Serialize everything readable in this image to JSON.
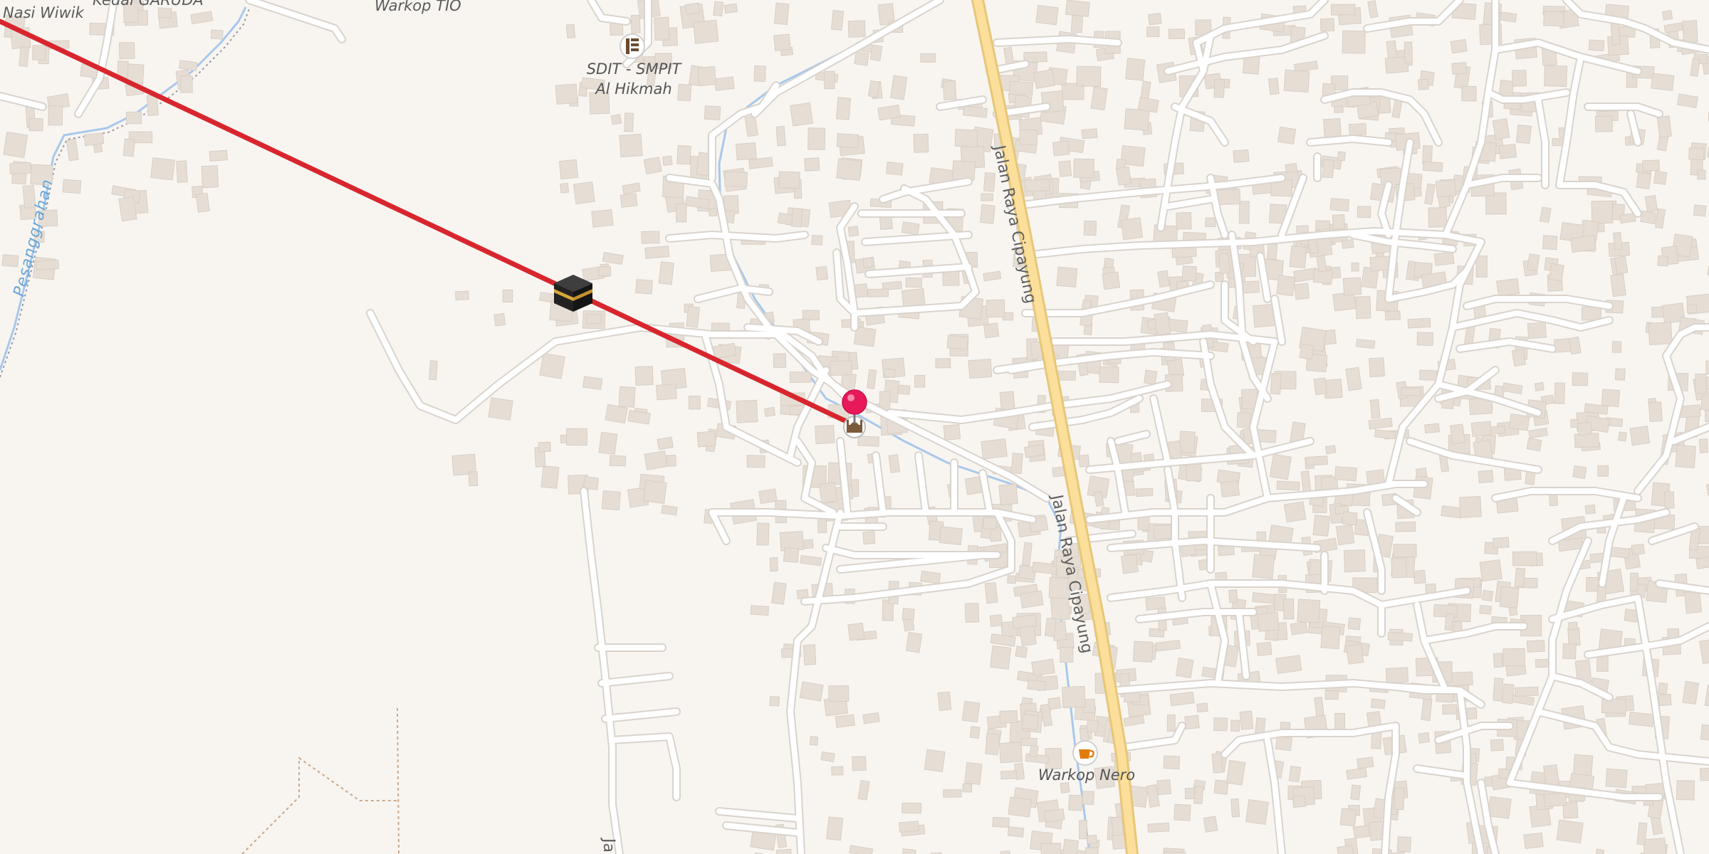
{
  "map": {
    "labels": {
      "nasi_wiwik": "Nasi Wiwik",
      "kedai_garuda": "Kedai GARUDA",
      "warkop_tio": "Warkop TIO",
      "school_line1": "SDIT - SMPIT",
      "school_line2": "Al Hikmah",
      "river": "Pesanggrahan",
      "main_road_north": "Jalan Raya Cipayung",
      "main_road_south": "Jalan Raya Cipayung",
      "cafe": "Warkop Nero",
      "bottom_road": "Ja"
    },
    "icons": {
      "kaaba": "kaaba-icon",
      "pin": "location-pin-icon",
      "mosque": "mosque-icon",
      "school": "school-icon",
      "cafe": "coffee-cup-icon"
    },
    "colors": {
      "background": "#f8f5f1",
      "building": "#e6ded5",
      "road": "#ffffff",
      "road_casing": "#dcd6cf",
      "main_road": "#fbdf9a",
      "main_road_casing": "#e6c77a",
      "river": "#a8c8ec",
      "qibla_line": "#d8262e",
      "pin": "#e8195a",
      "cafe_icon": "#e07b0e"
    }
  }
}
